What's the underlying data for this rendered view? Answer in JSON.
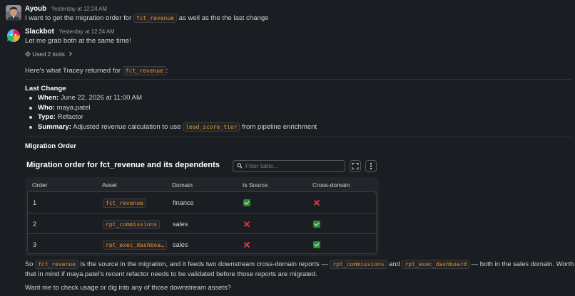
{
  "messages": {
    "user": {
      "name": "Ayoub",
      "time": "Yesterday at 12:24 AM",
      "text_before": "I want to get the migration order for",
      "code": "fct_revenue",
      "text_after": "as well as the the last change"
    },
    "bot": {
      "name": "Slackbot",
      "time": "Yesterday at 12:24 AM",
      "intro": "Let me grab both at the same time!",
      "tools_label": "Used 2 tools",
      "returned_before": "Here's what Tracey returned for",
      "returned_code": "fct_revenue",
      "returned_after": ":"
    }
  },
  "last_change": {
    "heading": "Last Change",
    "items": [
      {
        "label": "When:",
        "value": "June 22, 2026 at 11:00 AM"
      },
      {
        "label": "Who:",
        "value": "maya.patel"
      },
      {
        "label": "Type:",
        "value": "Refactor"
      },
      {
        "label": "Summary:",
        "value_before": "Adjusted revenue calculation to use",
        "code": "lead_score_tier",
        "value_after": "from pipeline enrichment"
      }
    ]
  },
  "migration": {
    "heading": "Migration Order",
    "table_title": "Migration order for fct_revenue and its dependents",
    "filter_placeholder": "Filter table...",
    "columns": [
      "Order",
      "Asset",
      "Domain",
      "Is Source",
      "Cross-domain"
    ],
    "rows": [
      {
        "order": "1",
        "asset": "fct_revenue",
        "domain": "finance",
        "is_source": true,
        "cross_domain": false
      },
      {
        "order": "2",
        "asset": "rpt_commissions",
        "domain": "sales",
        "is_source": false,
        "cross_domain": true
      },
      {
        "order": "3",
        "asset": "rpt_exec_dashboa…",
        "domain": "sales",
        "is_source": false,
        "cross_domain": true
      }
    ]
  },
  "summary": {
    "so": "So",
    "code1": "fct_revenue",
    "t1": "is the source in the migration, and it feeds two downstream cross-domain reports —",
    "code2": "rpt_commissions",
    "t2": "and",
    "code3": "rpt_exec_dashboard",
    "t3": "— both in the sales domain. Worth keeping",
    "line2": "that in mind if maya.patel's recent refactor needs to be validated before those reports are migrated.",
    "question": "Want me to check usage or dig into any of those downstream assets?"
  },
  "colors": {
    "background": "#1a1d21",
    "code_text": "#e8912d",
    "check": "#2e8b36",
    "cross": "#e0393e"
  },
  "icons": [
    "ayoub-avatar",
    "slackbot-logo",
    "gear-icon",
    "chevron-right-icon",
    "search-icon",
    "expand-icon",
    "more-vertical-icon",
    "check-icon",
    "cross-icon"
  ]
}
